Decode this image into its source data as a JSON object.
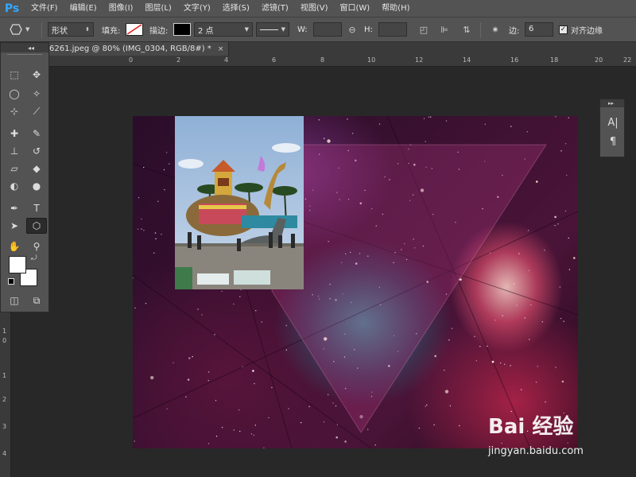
{
  "app": {
    "logo": "Ps"
  },
  "menu": [
    "文件(F)",
    "编辑(E)",
    "图像(I)",
    "图层(L)",
    "文字(Y)",
    "选择(S)",
    "滤镜(T)",
    "视图(V)",
    "窗口(W)",
    "帮助(H)"
  ],
  "options": {
    "mode": "形状",
    "fill_label": "填充:",
    "stroke_label": "描边:",
    "stroke_width": "2 点",
    "w_label": "W:",
    "h_label": "H:",
    "sides_label": "边:",
    "sides_value": "6",
    "smooth_label": "对齐边缘",
    "smooth_checked": "✓"
  },
  "tab": {
    "title": "6261.jpeg @ 80% (IMG_0304, RGB/8#) *",
    "close": "×"
  },
  "ruler": {
    "h": [
      "0",
      "2",
      "4",
      "6",
      "8",
      "10",
      "12",
      "14",
      "16",
      "18",
      "20",
      "22"
    ],
    "v": [
      "1",
      "0",
      "1",
      "2",
      "3",
      "4"
    ]
  },
  "colors": {
    "foreground": "#ffffff",
    "background": "#ffffff",
    "accent": "#31a8ff"
  },
  "watermark": {
    "logo": "Bai 经验",
    "url": "jingyan.baidu.com"
  }
}
